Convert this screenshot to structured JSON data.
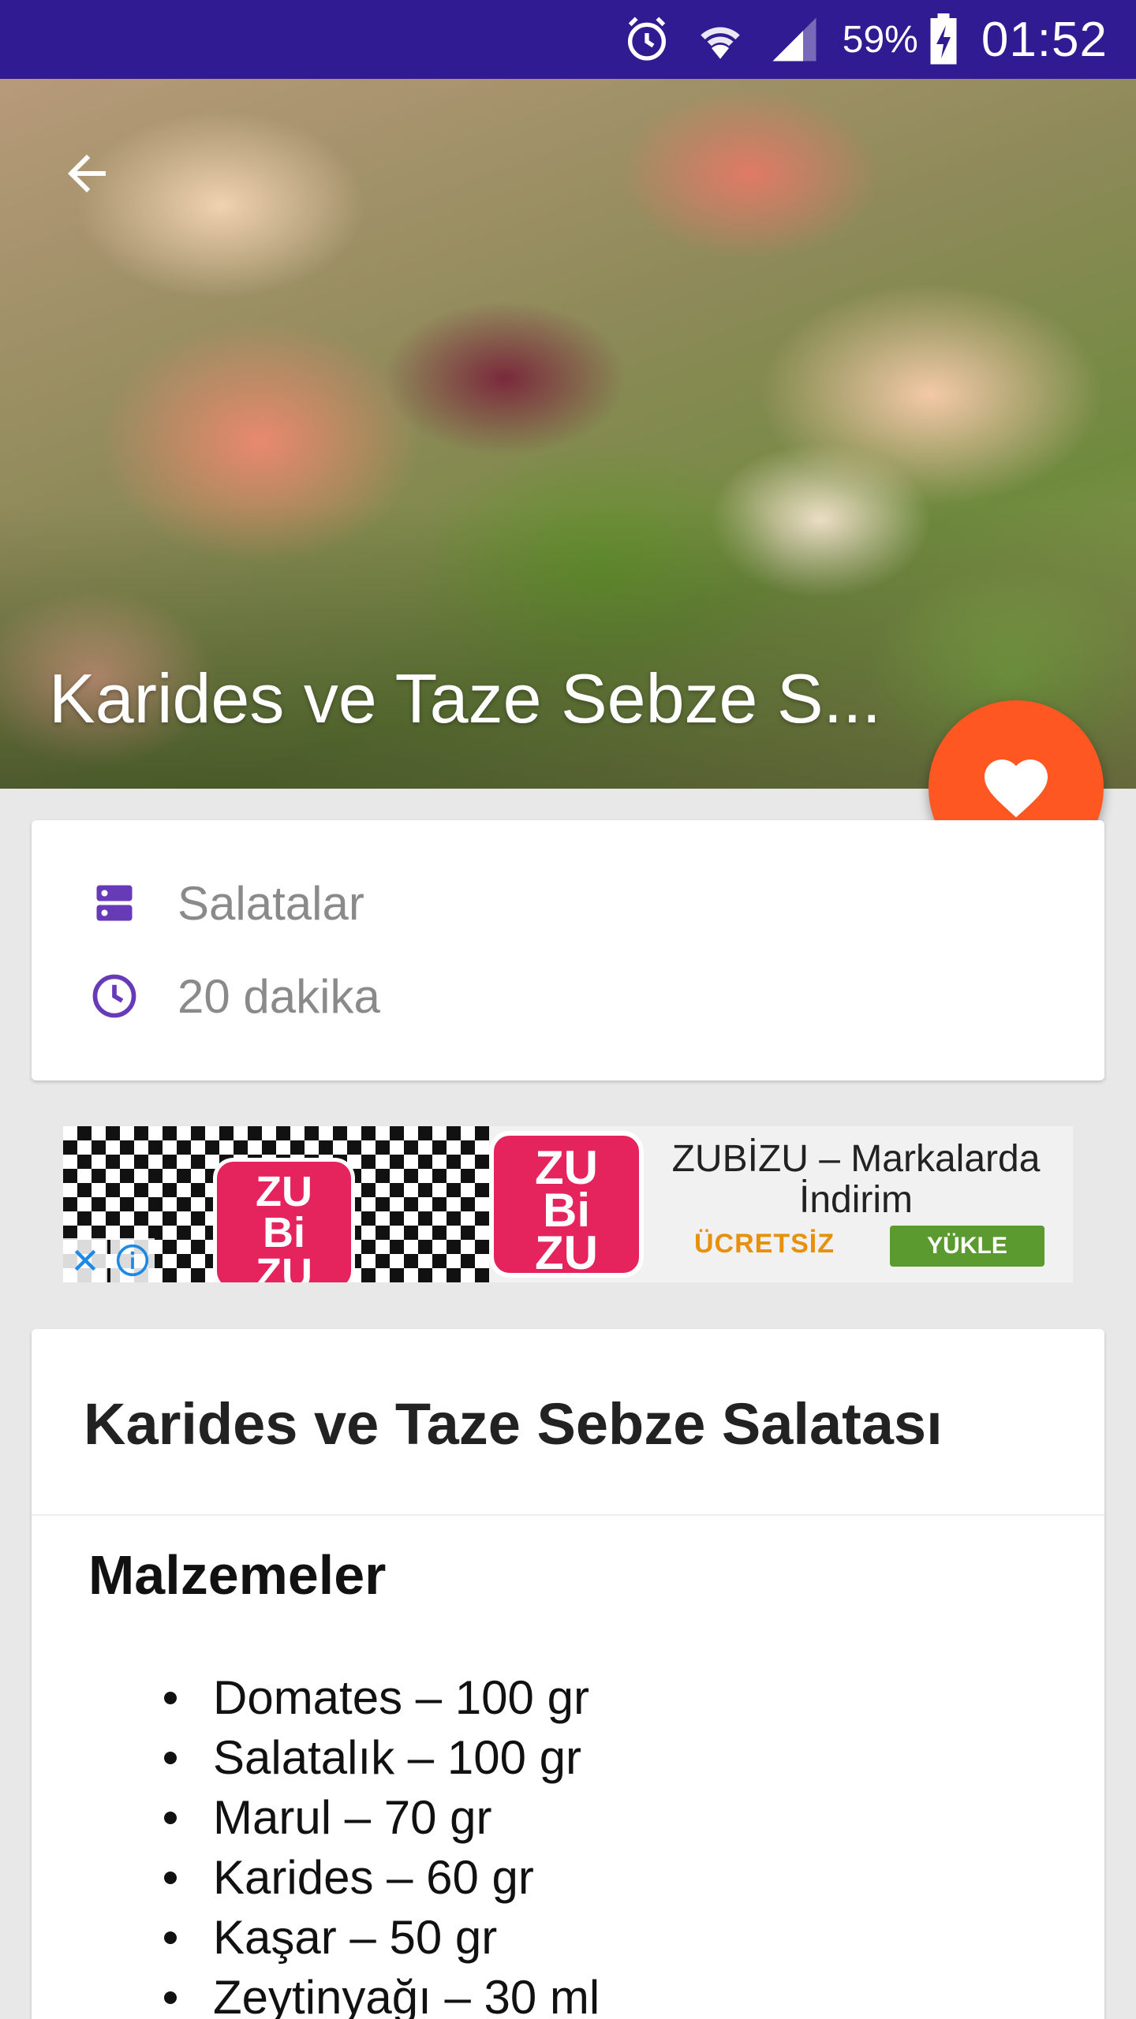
{
  "status_bar": {
    "battery_percent": "59%",
    "time": "01:52",
    "icons": [
      "alarm-icon",
      "wifi-icon",
      "signal-icon",
      "battery-charging-icon"
    ]
  },
  "hero": {
    "title": "Karides ve Taze Sebze S...",
    "back_icon": "arrow-left-icon"
  },
  "fab": {
    "icon": "heart-icon",
    "color": "#ff5722"
  },
  "info": {
    "category_icon": "category-icon",
    "category": "Salatalar",
    "time_icon": "clock-icon",
    "duration": "20  dakika",
    "accent_color": "#673ab7"
  },
  "ad": {
    "logo_text": [
      "ZU",
      "Bi",
      "ZU"
    ],
    "title": "ZUBİZU – Markalarda İndirim",
    "free_label": "ÜCRETSİZ",
    "install_label": "YÜKLE"
  },
  "recipe": {
    "title": "Karides ve Taze Sebze Salatası",
    "section_heading": "Malzemeler",
    "ingredients": [
      "Domates – 100 gr",
      "Salatalık – 100 gr",
      "Marul – 70 gr",
      "Karides – 60 gr",
      "Kaşar – 50 gr",
      "Zeytinyağı – 30 ml"
    ]
  },
  "colors": {
    "status_bar": "#311b92",
    "background": "#e8e8e8"
  }
}
